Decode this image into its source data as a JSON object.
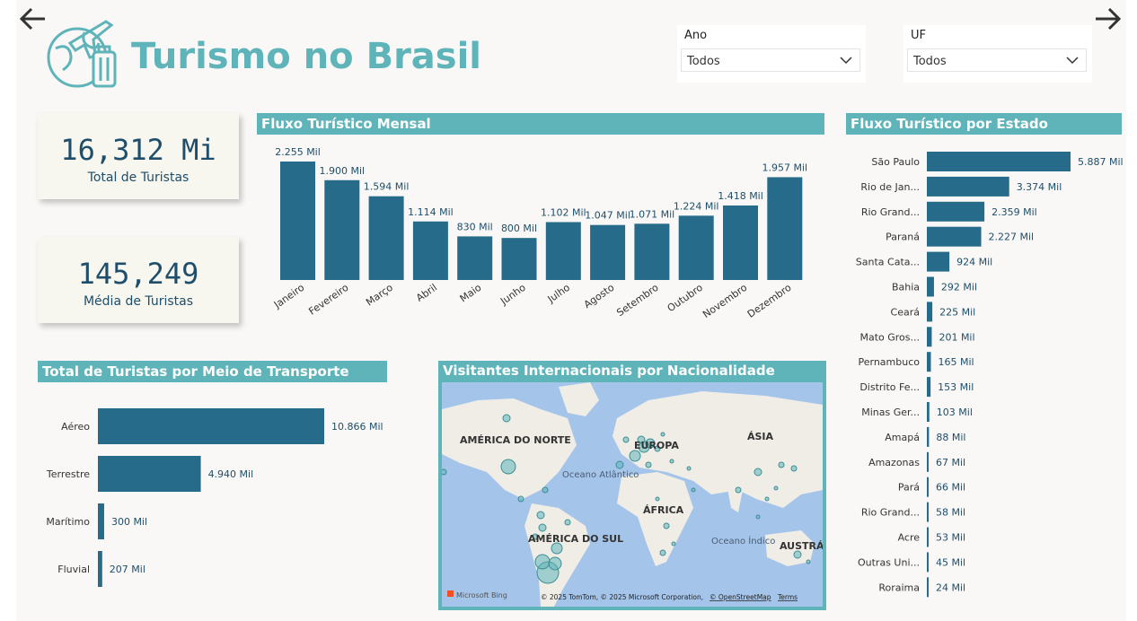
{
  "header": {
    "title": "Turismo no Brasil"
  },
  "filters": {
    "ano": {
      "label": "Ano",
      "value": "Todos"
    },
    "uf": {
      "label": "UF",
      "value": "Todos"
    }
  },
  "kpis": {
    "total": {
      "value": "16,312 Mi",
      "caption": "Total de Turistas"
    },
    "media": {
      "value": "145,249",
      "caption": "Média de Turistas"
    }
  },
  "colors": {
    "accent": "#5fb4b9",
    "bar": "#266b8a",
    "text": "#1e4e6a"
  },
  "chart_data": [
    {
      "type": "bar",
      "title": "Fluxo Turístico Mensal",
      "categories": [
        "Janeiro",
        "Fevereiro",
        "Março",
        "Abril",
        "Maio",
        "Junho",
        "Julho",
        "Agosto",
        "Setembro",
        "Outubro",
        "Novembro",
        "Dezembro"
      ],
      "values": [
        2255,
        1900,
        1594,
        1114,
        830,
        800,
        1102,
        1047,
        1071,
        1224,
        1418,
        1957
      ],
      "labels": [
        "2.255 Mil",
        "1.900 Mil",
        "1.594 Mil",
        "1.114 Mil",
        "830 Mil",
        "800 Mil",
        "1.102 Mil",
        "1.047 Mil",
        "1.071 Mil",
        "1.224 Mil",
        "1.418 Mil",
        "1.957 Mil"
      ]
    },
    {
      "type": "bar",
      "orientation": "horizontal",
      "title": "Fluxo Turístico por Estado",
      "categories": [
        "São Paulo",
        "Rio de Jan...",
        "Rio Grand...",
        "Paraná",
        "Santa Cata...",
        "Bahia",
        "Ceará",
        "Mato Gros...",
        "Pernambuco",
        "Distrito Fe...",
        "Minas Ger...",
        "Amapá",
        "Amazonas",
        "Pará",
        "Rio Grand...",
        "Acre",
        "Outras Uni...",
        "Roraima"
      ],
      "values": [
        5887,
        3374,
        2359,
        2227,
        924,
        292,
        225,
        201,
        165,
        153,
        103,
        88,
        67,
        66,
        58,
        53,
        45,
        24
      ],
      "labels": [
        "5.887 Mil",
        "3.374 Mil",
        "2.359 Mil",
        "2.227 Mil",
        "924 Mil",
        "292 Mil",
        "225 Mil",
        "201 Mil",
        "165 Mil",
        "153 Mil",
        "103 Mil",
        "88 Mil",
        "67 Mil",
        "66 Mil",
        "58 Mil",
        "53 Mil",
        "45 Mil",
        "24 Mil"
      ]
    },
    {
      "type": "bar",
      "orientation": "horizontal",
      "title": "Total de Turistas por Meio de Transporte",
      "categories": [
        "Aéreo",
        "Terrestre",
        "Marítimo",
        "Fluvial"
      ],
      "values": [
        10866,
        4940,
        300,
        207
      ],
      "labels": [
        "10.866 Mil",
        "4.940 Mil",
        "300 Mil",
        "207 Mil"
      ]
    }
  ],
  "map": {
    "title": "Visitantes Internacionais por Nacionalidade",
    "labels": {
      "north_america": "AMÉRICA DO NORTE",
      "europe": "EUROPA",
      "asia": "ÁSIA",
      "africa": "ÁFRICA",
      "south_america": "AMÉRICA DO SUL",
      "australia": "AUSTRÁL",
      "atlantic": "Oceano Atlântico",
      "indian": "Oceano Índico"
    },
    "brand": "Microsoft Bing",
    "copyright": "© 2025 TomTom, © 2025 Microsoft Corporation,",
    "osm": "© OpenStreetMap",
    "terms": "Terms"
  }
}
